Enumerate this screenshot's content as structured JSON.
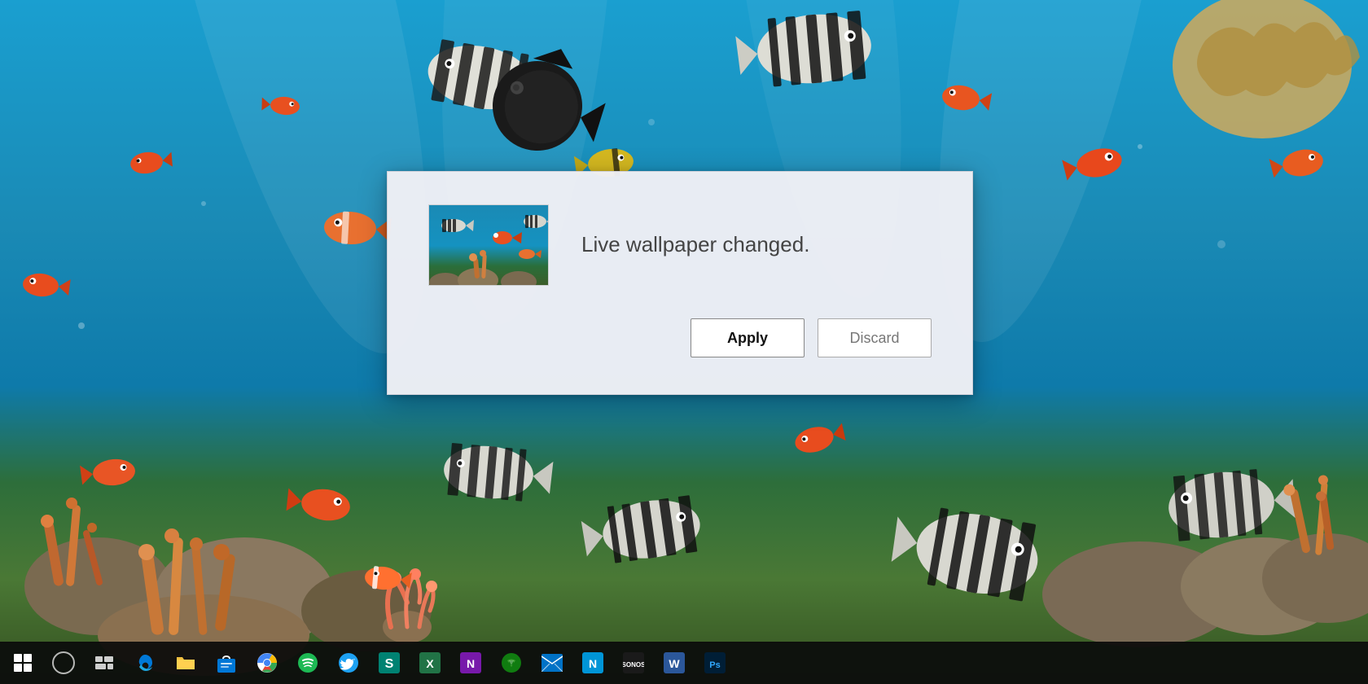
{
  "desktop": {
    "background": "underwater coral reef with tropical fish"
  },
  "dialog": {
    "message": "Live wallpaper changed.",
    "apply_label": "Apply",
    "discard_label": "Discard",
    "thumbnail_alt": "underwater coral reef wallpaper preview"
  },
  "taskbar": {
    "icons": [
      {
        "name": "start",
        "label": "Start"
      },
      {
        "name": "cortana",
        "label": "Cortana Search"
      },
      {
        "name": "task-view",
        "label": "Task View"
      },
      {
        "name": "edge",
        "label": "Microsoft Edge"
      },
      {
        "name": "file-explorer",
        "label": "File Explorer"
      },
      {
        "name": "store",
        "label": "Microsoft Store"
      },
      {
        "name": "chrome",
        "label": "Google Chrome"
      },
      {
        "name": "spotify",
        "label": "Spotify"
      },
      {
        "name": "twitter",
        "label": "Twitter"
      },
      {
        "name": "sway",
        "label": "Microsoft Sway"
      },
      {
        "name": "excel",
        "label": "Microsoft Excel"
      },
      {
        "name": "onenote",
        "label": "Microsoft OneNote"
      },
      {
        "name": "xbox",
        "label": "Xbox"
      },
      {
        "name": "mail",
        "label": "Mail"
      },
      {
        "name": "note",
        "label": "Note app"
      },
      {
        "name": "sonos",
        "label": "Sonos"
      },
      {
        "name": "word",
        "label": "Microsoft Word"
      },
      {
        "name": "photoshop",
        "label": "Adobe Photoshop"
      }
    ]
  }
}
